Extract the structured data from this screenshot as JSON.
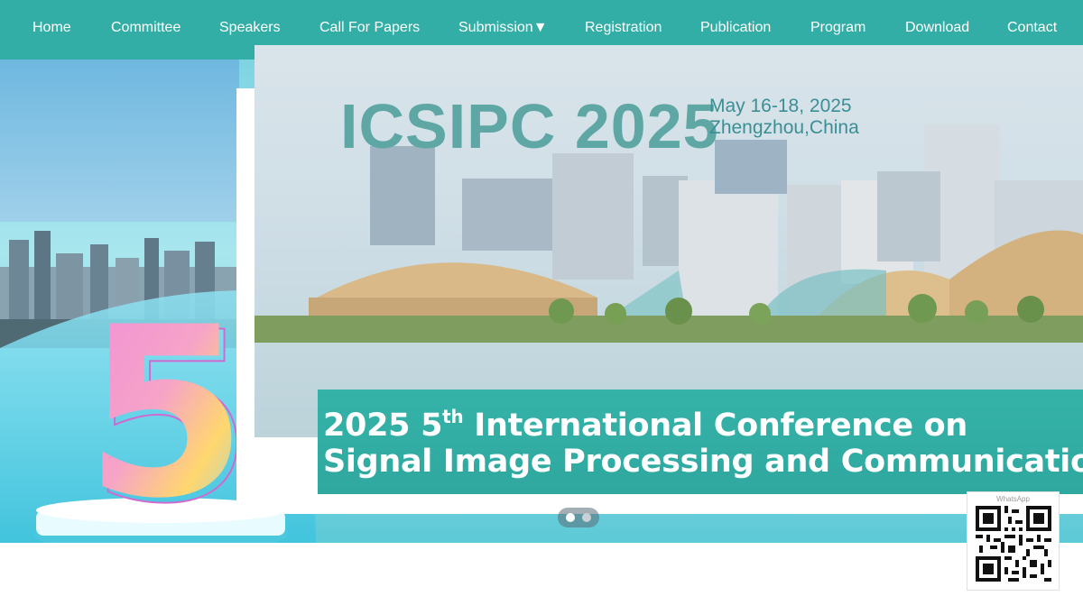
{
  "nav": {
    "items": [
      {
        "label": "Home"
      },
      {
        "label": "Committee"
      },
      {
        "label": "Speakers"
      },
      {
        "label": "Call For Papers"
      },
      {
        "label": "Submission▼"
      },
      {
        "label": "Registration"
      },
      {
        "label": "Publication"
      },
      {
        "label": "Program"
      },
      {
        "label": "Download"
      },
      {
        "label": "Contact"
      }
    ]
  },
  "banner": {
    "code": "ICSIPC  2025",
    "date": "May 16-18, 2025",
    "location": "Zhengzhou,China",
    "title_line1_pre": "2025 5",
    "title_line1_sup": "th",
    "title_line1_post": " International Conference on",
    "title_line2": "Signal Image Processing and Communication",
    "badge_number": "5"
  },
  "carousel": {
    "slide_count": 2,
    "active_index": 0
  },
  "qr": {
    "label": "WhatsApp"
  },
  "colors": {
    "nav_bg": "#33aea6",
    "band_bg": "#2fa89f",
    "code_text": "#5fa7a4"
  }
}
